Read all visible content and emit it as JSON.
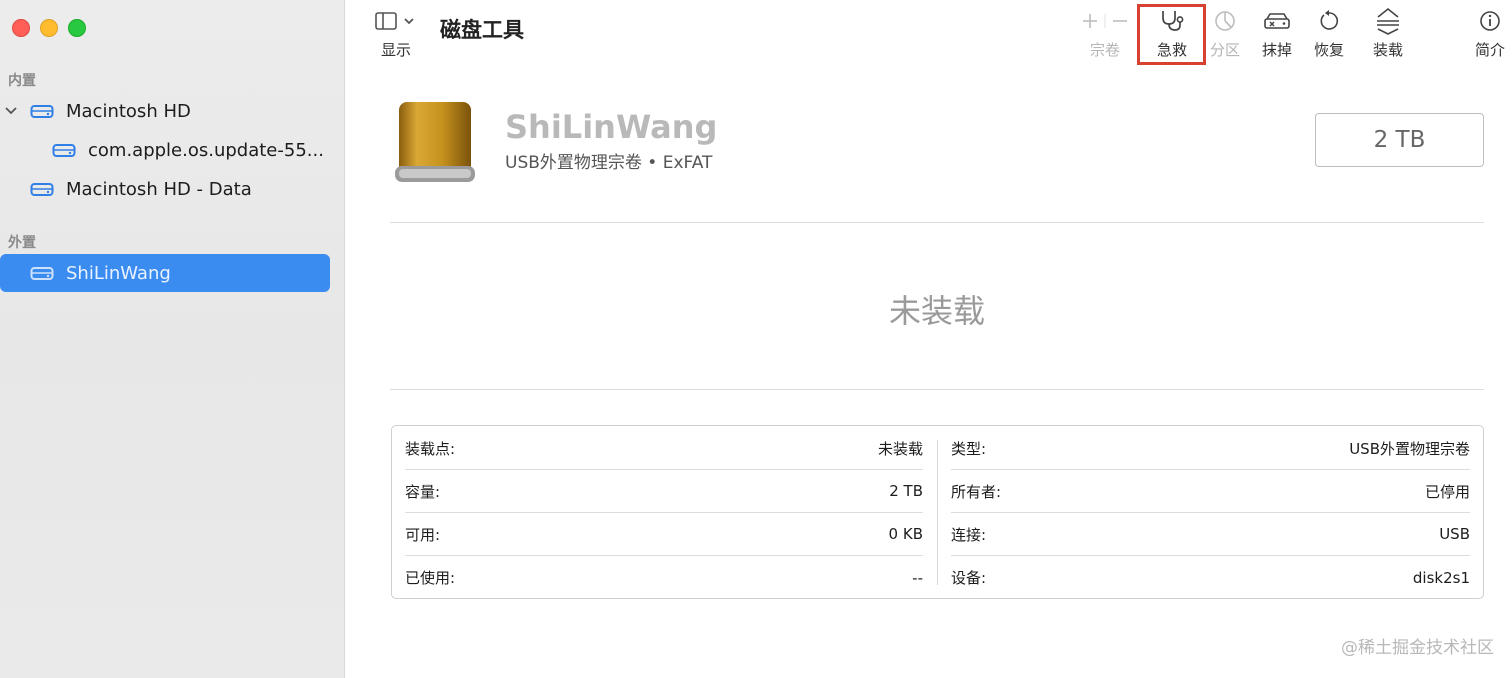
{
  "sidebar": {
    "sections": [
      {
        "label": "内置"
      },
      {
        "label": "外置"
      }
    ],
    "items": [
      {
        "label": "Macintosh HD"
      },
      {
        "label": "com.apple.os.update-55..."
      },
      {
        "label": "Macintosh HD - Data"
      },
      {
        "label": "ShiLinWang"
      }
    ]
  },
  "toolbar": {
    "view_label": "显示",
    "app_title": "磁盘工具",
    "buttons": [
      {
        "label": "宗卷",
        "icon": "plus-minus-icon",
        "enabled": false
      },
      {
        "label": "急救",
        "icon": "stethoscope-icon",
        "enabled": true
      },
      {
        "label": "分区",
        "icon": "pie-chart-icon",
        "enabled": false
      },
      {
        "label": "抹掉",
        "icon": "erase-drive-icon",
        "enabled": true
      },
      {
        "label": "恢复",
        "icon": "restore-icon",
        "enabled": true
      },
      {
        "label": "装载",
        "icon": "mount-icon",
        "enabled": true
      },
      {
        "label": "简介",
        "icon": "info-icon",
        "enabled": true
      }
    ],
    "highlight_color": "#d8412f"
  },
  "disk": {
    "name": "ShiLinWang",
    "subtitle": "USB外置物理宗卷 • ExFAT",
    "capacity": "2 TB",
    "status": "未装载",
    "icon_color": "#c8961f"
  },
  "info": {
    "left": [
      {
        "key": "装载点:",
        "value": "未装载"
      },
      {
        "key": "容量:",
        "value": "2 TB"
      },
      {
        "key": "可用:",
        "value": "0 KB"
      },
      {
        "key": "已使用:",
        "value": "--"
      }
    ],
    "right": [
      {
        "key": "类型:",
        "value": "USB外置物理宗卷"
      },
      {
        "key": "所有者:",
        "value": "已停用"
      },
      {
        "key": "连接:",
        "value": "USB"
      },
      {
        "key": "设备:",
        "value": "disk2s1"
      }
    ]
  },
  "watermark": "@稀土掘金技术社区",
  "colors": {
    "accent": "#3b8cf0",
    "drive_blue": "#2f7fe6"
  }
}
